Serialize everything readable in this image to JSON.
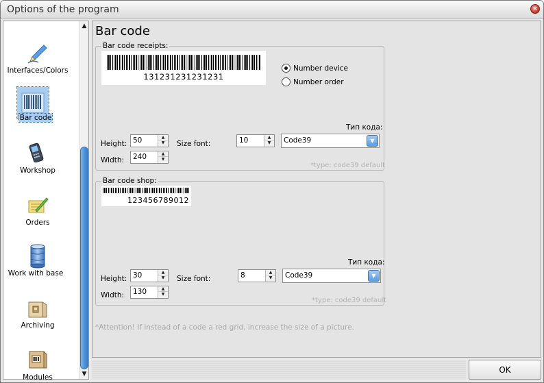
{
  "window": {
    "title": "Options of the program"
  },
  "sidebar": {
    "items": [
      {
        "label": "Interfaces/Colors",
        "icon": "pen-icon",
        "selected": false
      },
      {
        "label": "Bar code",
        "icon": "barcode-icon",
        "selected": true
      },
      {
        "label": "Workshop",
        "icon": "phone-icon",
        "selected": false
      },
      {
        "label": "Orders",
        "icon": "orders-icon",
        "selected": false
      },
      {
        "label": "Work with base",
        "icon": "database-icon",
        "selected": false
      },
      {
        "label": "Archiving",
        "icon": "archive-icon",
        "selected": false
      },
      {
        "label": "Modules",
        "icon": "modules-icon",
        "selected": false
      }
    ]
  },
  "main": {
    "title": "Bar code",
    "receipts": {
      "group_label": "Bar code receipts:",
      "barcode_number": "131231231231231",
      "radio_options": [
        {
          "label": "Number device",
          "checked": true
        },
        {
          "label": "Number order",
          "checked": false
        }
      ],
      "height_label": "Height:",
      "height_value": "50",
      "width_label": "Width:",
      "width_value": "240",
      "size_font_label": "Size  font:",
      "size_font_value": "10",
      "code_type_label": "Тип кода:",
      "code_type_value": "Code39",
      "hint": "*type: code39 default"
    },
    "shop": {
      "group_label": "Bar code shop:",
      "barcode_number": "123456789012",
      "height_label": "Height:",
      "height_value": "30",
      "width_label": "Width:",
      "width_value": "130",
      "size_font_label": "Size  font:",
      "size_font_value": "8",
      "code_type_label": "Тип кода:",
      "code_type_value": "Code39",
      "hint": "*type: code39 default"
    },
    "attention": "*Attention! If instead of a code a red grid, increase the size of a picture."
  },
  "footer": {
    "ok_label": "OK"
  },
  "colors": {
    "selection": "#a9cdf0",
    "scroll_thumb": "#4f95db",
    "close_button": "#c0392b"
  }
}
